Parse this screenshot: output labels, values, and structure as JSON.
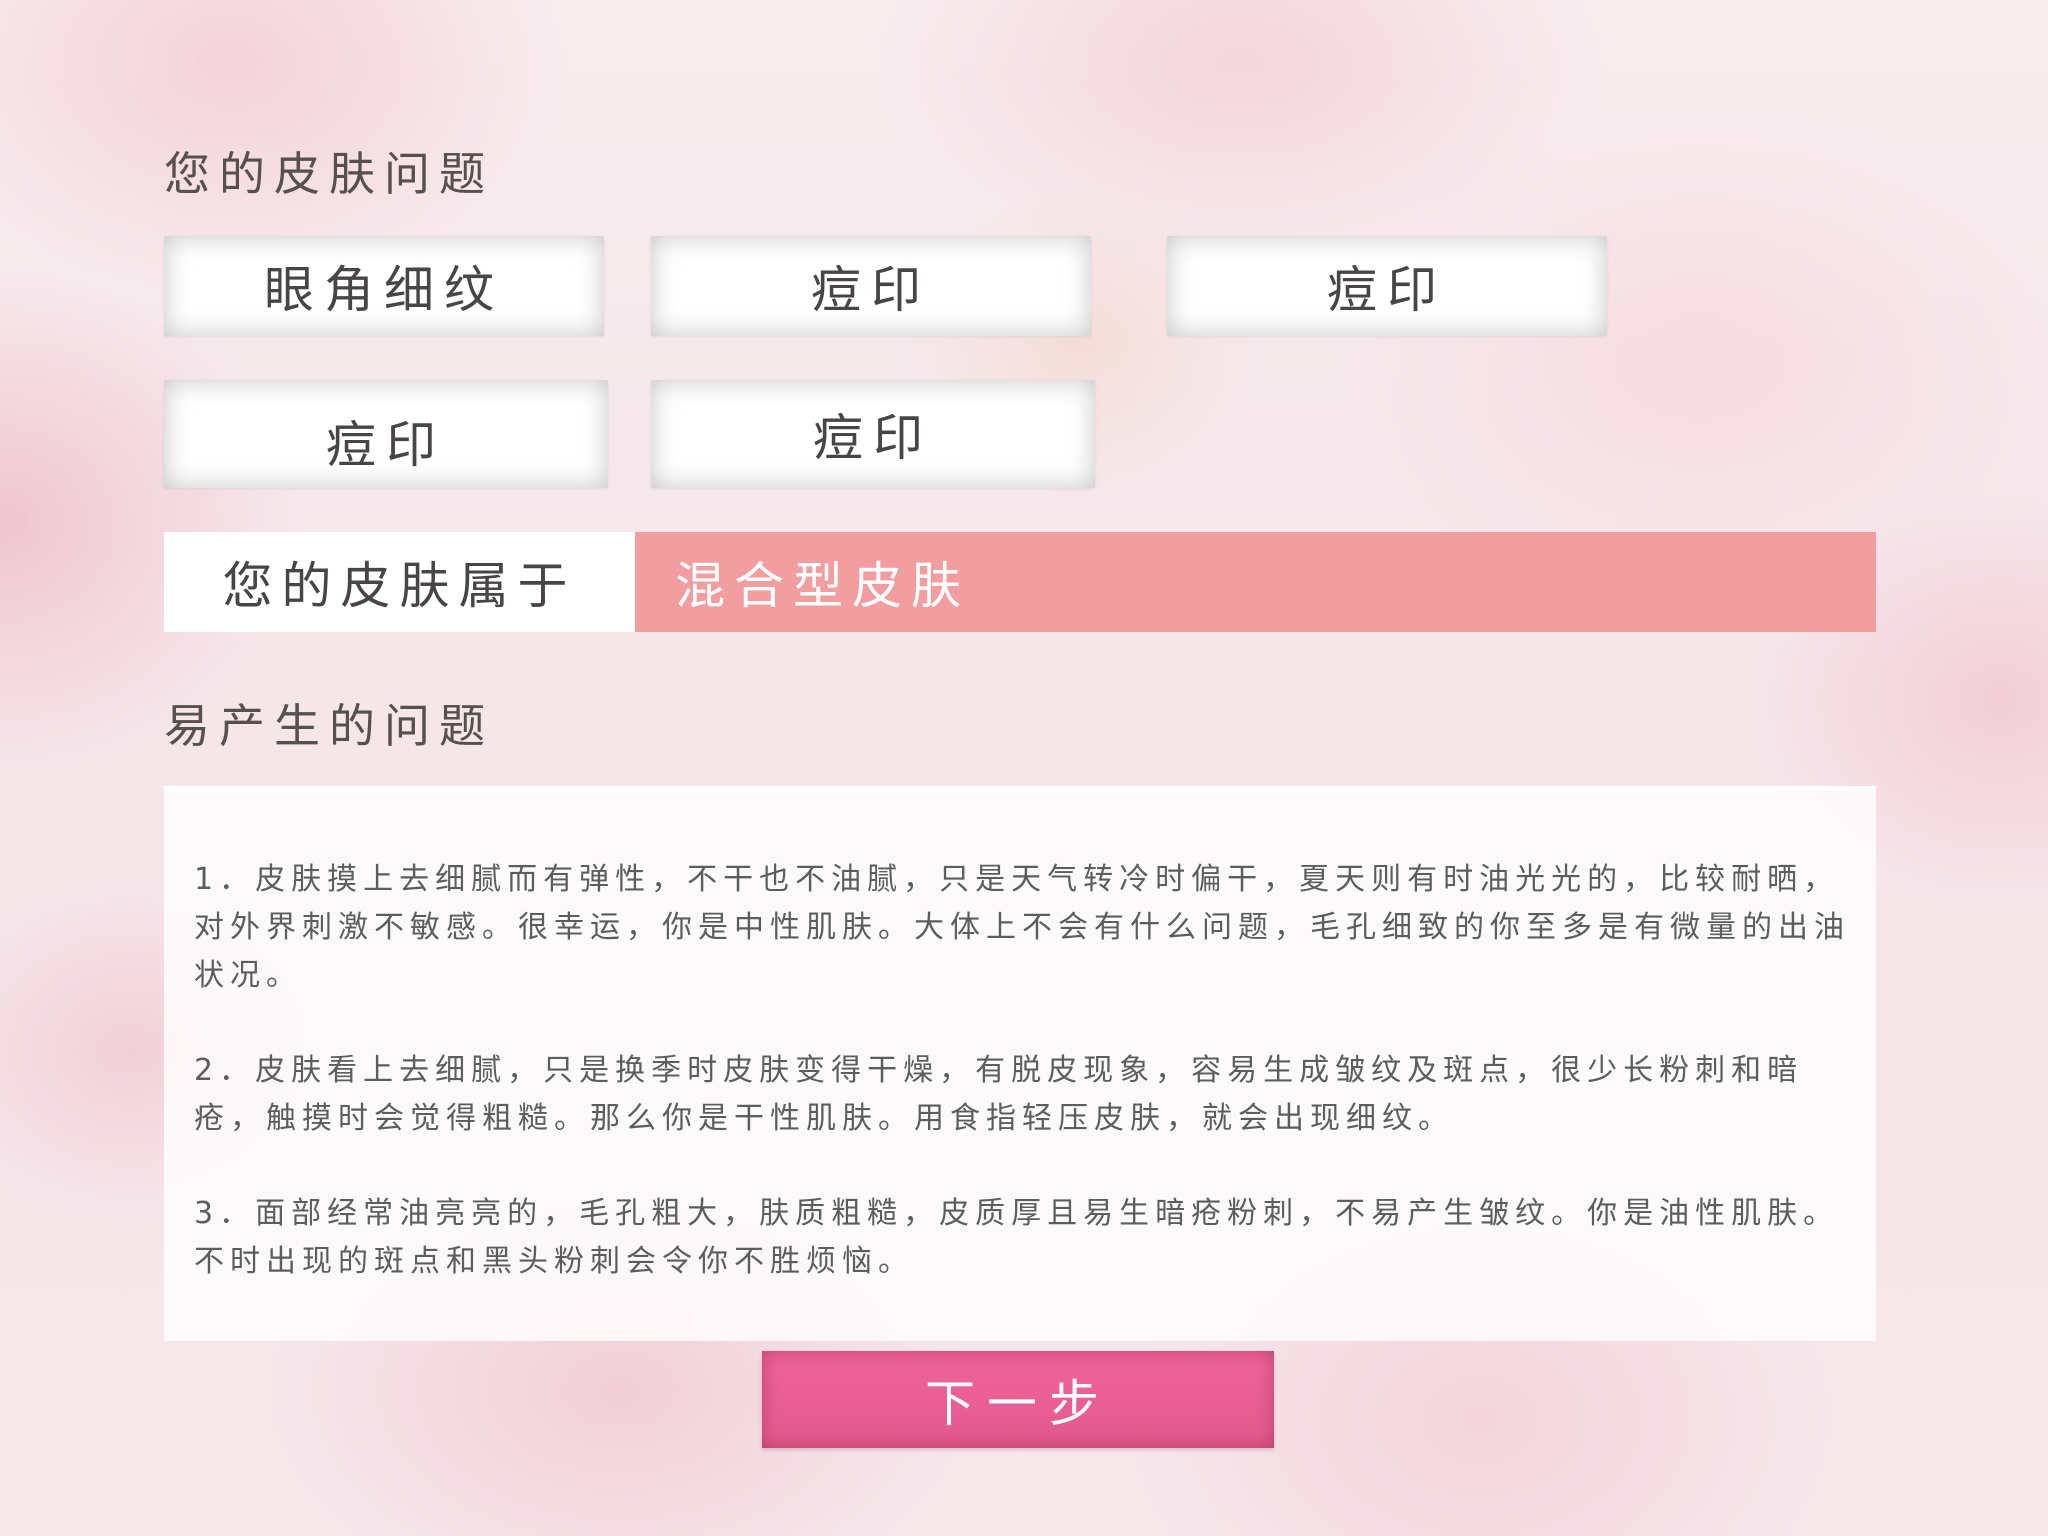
{
  "skin_problems": {
    "title": "您的皮肤问题",
    "tags": [
      "眼角细纹",
      "痘印",
      "痘印",
      "痘印",
      "痘印"
    ]
  },
  "skin_type": {
    "label": "您的皮肤属于",
    "value": "混合型皮肤"
  },
  "prone_problems": {
    "title": "易产生的问题",
    "paragraphs": [
      "1．皮肤摸上去细腻而有弹性，不干也不油腻，只是天气转冷时偏干，夏天则有时油光光的，比较耐晒，对外界刺激不敏感。很幸运，你是中性肌肤。大体上不会有什么问题，毛孔细致的你至多是有微量的出油状况。",
      "2．皮肤看上去细腻，只是换季时皮肤变得干燥，有脱皮现象，容易生成皱纹及斑点，很少长粉刺和暗疮，触摸时会觉得粗糙。那么你是干性肌肤。用食指轻压皮肤，就会出现细纹。",
      "3．面部经常油亮亮的，毛孔粗大，肤质粗糙，皮质厚且易生暗疮粉刺，不易产生皱纹。你是油性肌肤。不时出现的斑点和黑头粉刺会令你不胜烦恼。"
    ]
  },
  "next_button": {
    "label": "下一步"
  },
  "colors": {
    "skin_type_value_bg": "#f29ea1",
    "next_button_bg": "#f0649a",
    "heading_text": "#56504f"
  }
}
